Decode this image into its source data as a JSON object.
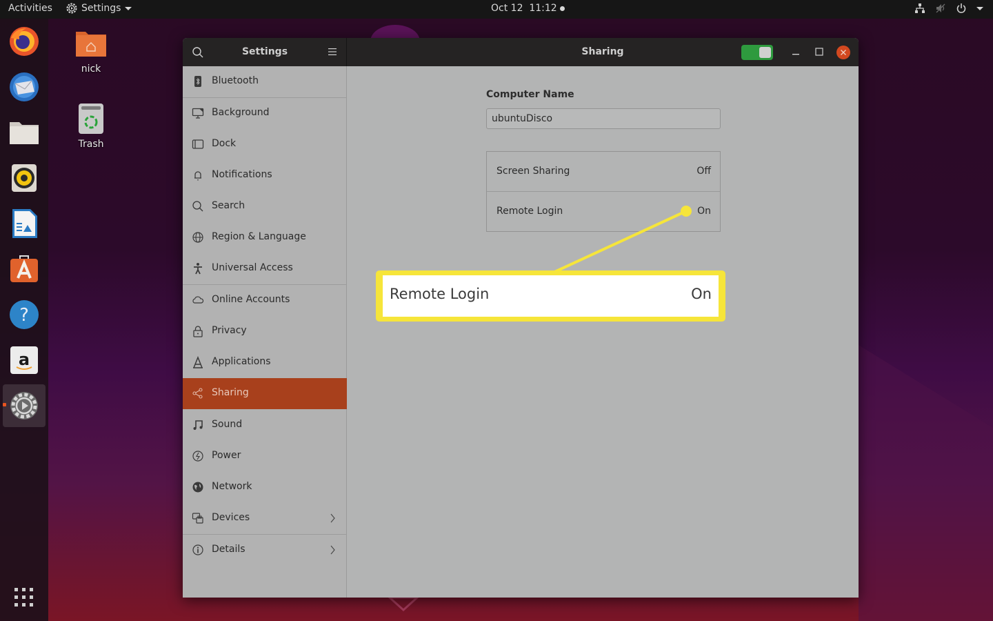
{
  "topbar": {
    "activities": "Activities",
    "app_menu": "Settings",
    "clock": "Oct 12  11:12",
    "tray_icons": [
      "network-icon",
      "volume-muted-icon",
      "power-icon",
      "menu-caret-icon"
    ]
  },
  "dock": {
    "items": [
      {
        "name": "Firefox",
        "icon": "firefox-icon"
      },
      {
        "name": "Thunderbird",
        "icon": "thunderbird-icon"
      },
      {
        "name": "Files",
        "icon": "files-icon"
      },
      {
        "name": "Rhythmbox",
        "icon": "rhythmbox-icon"
      },
      {
        "name": "LibreOffice Impress",
        "icon": "libreoffice-impress-icon"
      },
      {
        "name": "Ubuntu Software",
        "icon": "ubuntu-software-icon"
      },
      {
        "name": "Help",
        "icon": "help-icon"
      },
      {
        "name": "Amazon",
        "icon": "amazon-icon"
      },
      {
        "name": "Settings",
        "icon": "settings-icon",
        "active": true
      }
    ],
    "show_apps": "show-applications-icon"
  },
  "desktop": {
    "icons": [
      {
        "label": "nick",
        "icon": "home-folder-icon"
      },
      {
        "label": "Trash",
        "icon": "trash-icon"
      }
    ]
  },
  "window": {
    "sidebar_title": "Settings",
    "title": "Sharing",
    "sharing_enabled": true,
    "accent_color": "#a8401c",
    "switch_color": "#2e9a3e",
    "close_color": "#d3481f"
  },
  "sidebar": {
    "items": [
      {
        "label": "Bluetooth",
        "icon": "bluetooth-icon"
      },
      {
        "label": "Background",
        "icon": "background-icon"
      },
      {
        "label": "Dock",
        "icon": "dock-icon"
      },
      {
        "label": "Notifications",
        "icon": "bell-icon"
      },
      {
        "label": "Search",
        "icon": "search-icon"
      },
      {
        "label": "Region & Language",
        "icon": "globe-icon"
      },
      {
        "label": "Universal Access",
        "icon": "accessibility-icon"
      },
      {
        "label": "Online Accounts",
        "icon": "cloud-icon"
      },
      {
        "label": "Privacy",
        "icon": "lock-icon"
      },
      {
        "label": "Applications",
        "icon": "applications-icon"
      },
      {
        "label": "Sharing",
        "icon": "share-icon",
        "selected": true
      },
      {
        "label": "Sound",
        "icon": "music-note-icon"
      },
      {
        "label": "Power",
        "icon": "power-icon"
      },
      {
        "label": "Network",
        "icon": "network-globe-icon"
      },
      {
        "label": "Devices",
        "icon": "devices-icon",
        "has_submenu": true
      },
      {
        "label": "Details",
        "icon": "info-icon",
        "has_submenu": true
      }
    ]
  },
  "content": {
    "computer_name_label": "Computer Name",
    "computer_name_value": "ubuntuDisco",
    "services": [
      {
        "name": "Screen Sharing",
        "status": "Off"
      },
      {
        "name": "Remote Login",
        "status": "On"
      }
    ]
  },
  "callout": {
    "name": "Remote Login",
    "status": "On",
    "color": "#f6e53a"
  }
}
